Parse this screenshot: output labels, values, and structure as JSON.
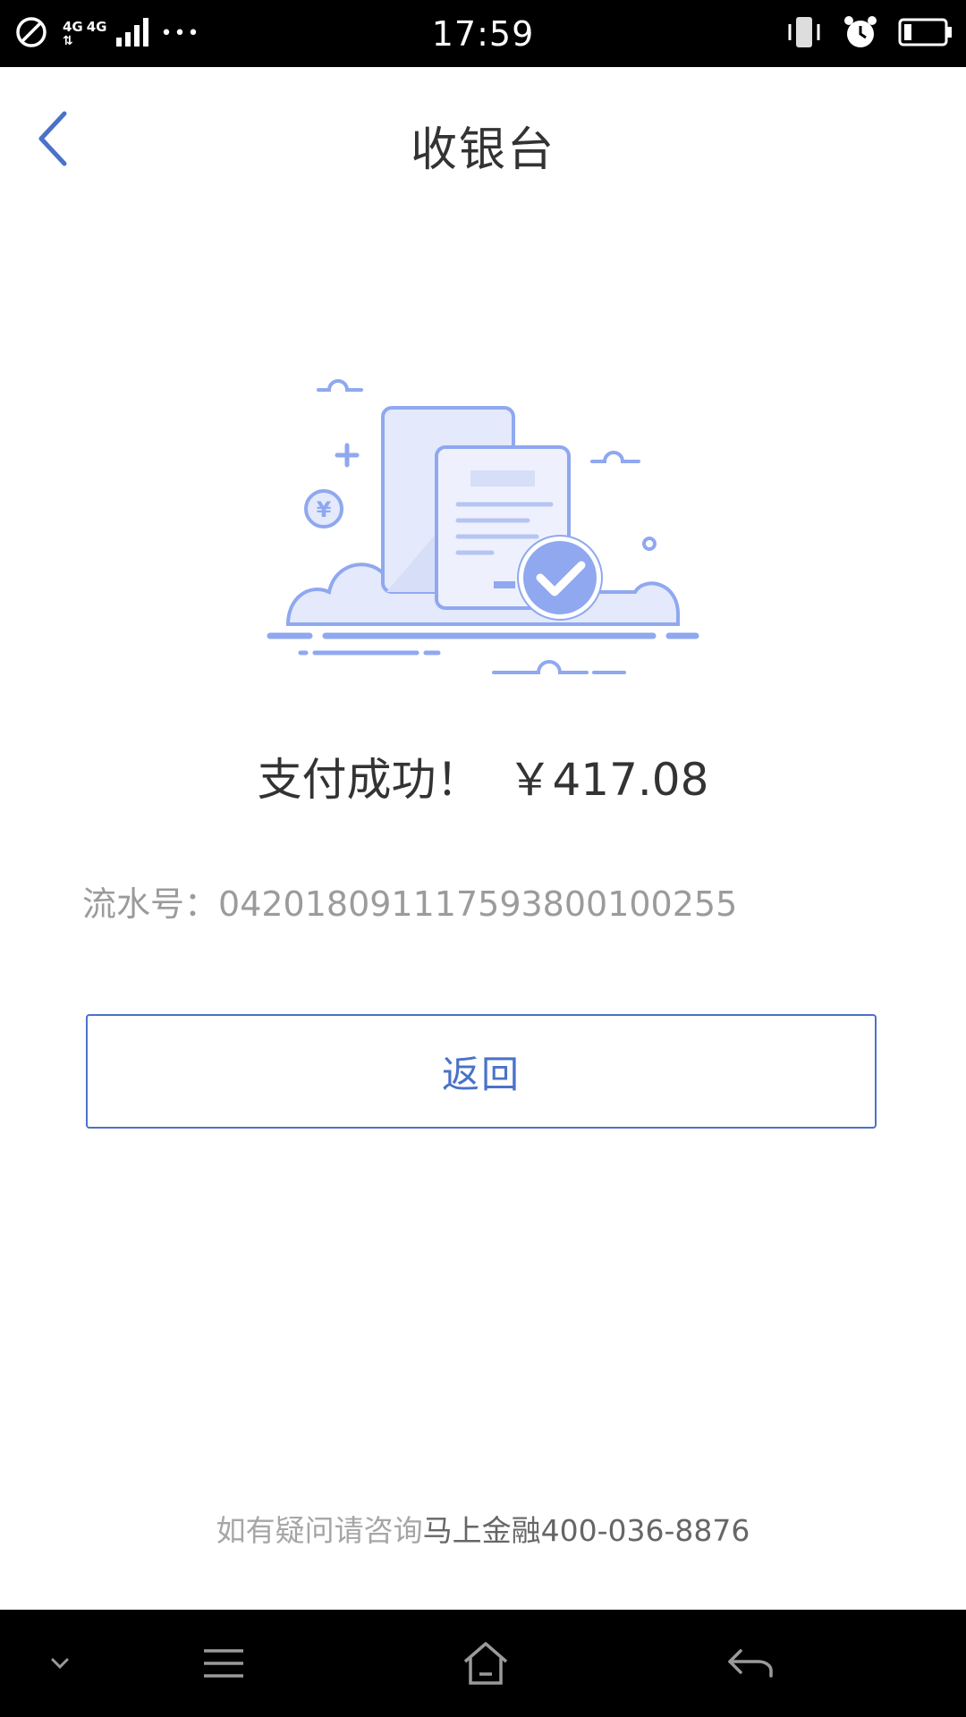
{
  "status_bar": {
    "time": "17:59",
    "network_label_1": "4G",
    "network_label_2": "4G",
    "more_dots": "•••",
    "icons": [
      "blocked-icon",
      "signal-icon",
      "vibrate-icon",
      "alarm-icon",
      "battery-icon"
    ]
  },
  "header": {
    "title": "收银台",
    "back_icon": "chevron-left-icon"
  },
  "result": {
    "message": "支付成功！",
    "amount": "￥417.08"
  },
  "serial": {
    "label": "流水号：",
    "value": "04201809111759380010025​5"
  },
  "actions": {
    "return_label": "返回"
  },
  "footer": {
    "note_prefix": "如有疑问请咨询",
    "company_phone": "马上金融400-036-8876"
  },
  "nav_bar": {
    "icons": [
      "chevron-down-icon",
      "menu-icon",
      "home-icon",
      "back-arrow-icon"
    ]
  },
  "colors": {
    "accent": "#4a72c9",
    "illustration_blue": "#8fa8ef",
    "illustration_fill": "#e4e9fb",
    "text_dark": "#333333",
    "text_gray": "#9b9b9b"
  }
}
